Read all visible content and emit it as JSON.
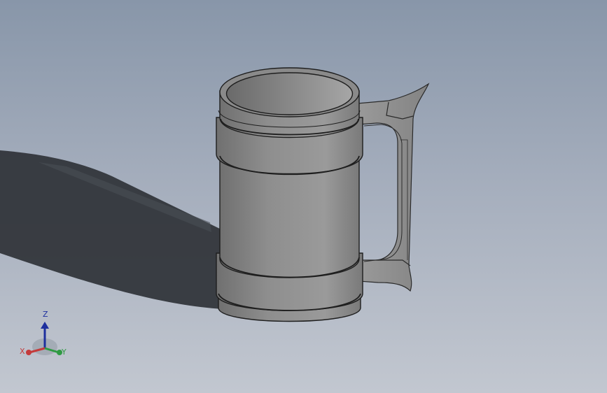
{
  "viewport": {
    "background_top": "#8896a9",
    "background_bottom": "#c2c7d0",
    "model": "beer-mug",
    "model_color": "#8e8e8e",
    "edge_color": "#2a2a2a"
  },
  "triad": {
    "z_label": "Z",
    "x_label": "X",
    "y_label": "Y",
    "z_color": "#1d2f9e",
    "x_color": "#c43b3b",
    "y_color": "#2f9a43"
  }
}
